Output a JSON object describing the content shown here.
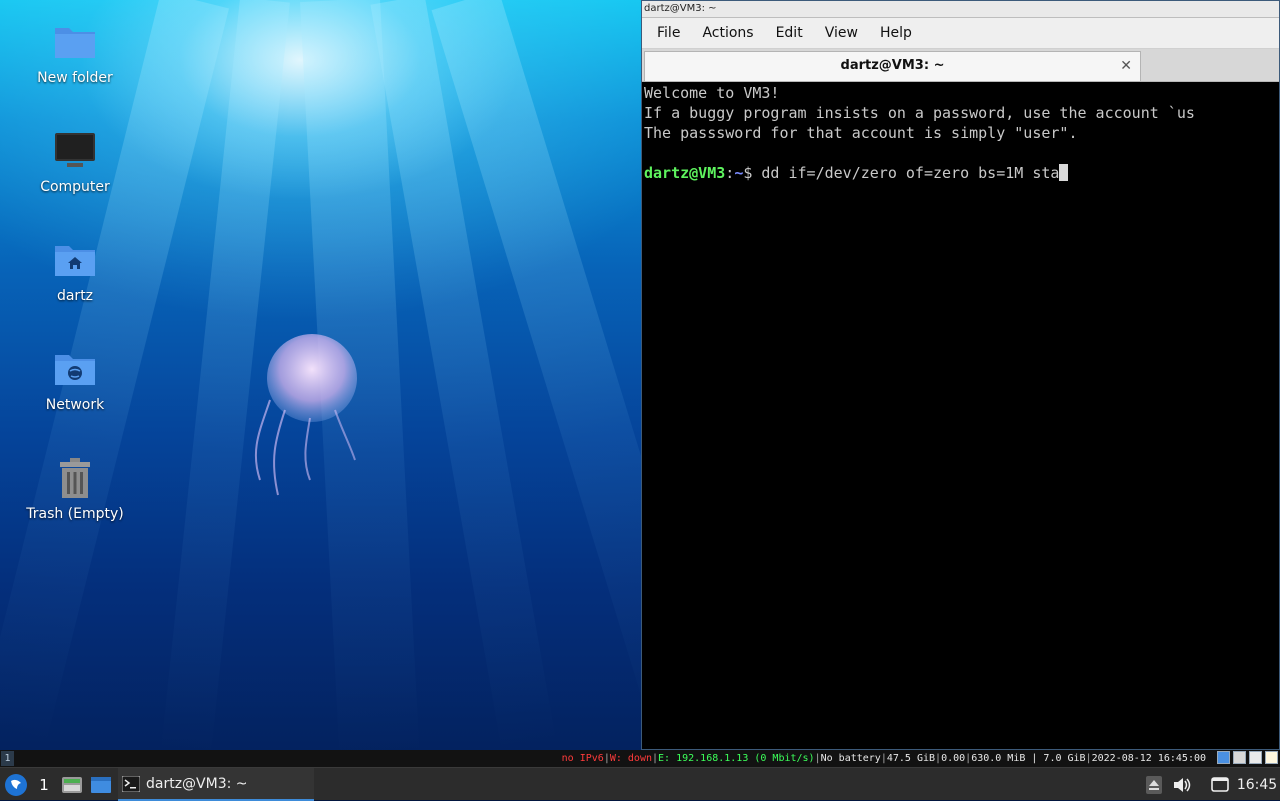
{
  "desktop": {
    "icons": [
      {
        "label": "New folder",
        "icon": "folder-icon"
      },
      {
        "label": "Computer",
        "icon": "computer-icon"
      },
      {
        "label": "dartz",
        "icon": "home-folder-icon"
      },
      {
        "label": "Network",
        "icon": "network-folder-icon"
      },
      {
        "label": "Trash (Empty)",
        "icon": "trash-icon"
      }
    ]
  },
  "terminal": {
    "window_title": "dartz@VM3: ~",
    "menu": [
      "File",
      "Actions",
      "Edit",
      "View",
      "Help"
    ],
    "tab_title": "dartz@VM3: ~",
    "lines": [
      "Welcome to VM3!",
      "If a buggy program insists on a password, use the account `us",
      "The passsword for that account is simply \"user\"."
    ],
    "prompt_user": "dartz@VM3",
    "prompt_sep": ":",
    "prompt_dir": "~",
    "prompt_end": "$ ",
    "command": "dd if=/dev/zero of=zero bs=1M sta"
  },
  "statusbar": {
    "workspace": "1",
    "ipv6": "no IPv6",
    "wifi": "W: down",
    "ethernet": "E: 192.168.1.13 (0 Mbit/s)",
    "battery": "No battery",
    "disk": "47.5 GiB",
    "load": "0.00",
    "memory": "630.0 MiB | 7.0 GiB",
    "datetime": "2022-08-12 16:45:00",
    "sep": "|"
  },
  "taskbar": {
    "workspace": "1",
    "task_label": "dartz@VM3: ~",
    "clock": "16:45"
  },
  "colors": {
    "prompt_user": "#5ef35e",
    "prompt_dir": "#7b8cff",
    "accent": "#3d8bd9"
  }
}
